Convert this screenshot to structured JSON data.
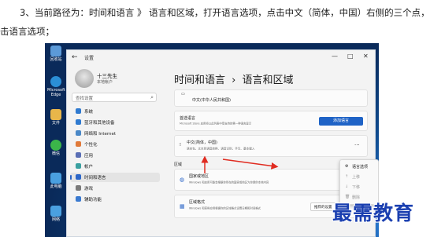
{
  "article": {
    "line1": "3、当前路径为：时间和语言 》 语言和区域，打开语言选项，点击中文（简体，中国）右侧的三个点，再点",
    "line2": "击语言选项；"
  },
  "desktop_icons": [
    {
      "label": "回收站",
      "color": "#5c9ad8"
    },
    {
      "label": "Microsoft Edge",
      "color": "#2b8fd6"
    },
    {
      "label": "文件",
      "color": "#e8b64a"
    },
    {
      "label": "微信",
      "color": "#3bb54a"
    },
    {
      "label": "此电脑",
      "color": "#4aa0e0"
    },
    {
      "label": "网络",
      "color": "#4aa0e0"
    }
  ],
  "window": {
    "title": "设置",
    "back": "←",
    "minimize": "—",
    "maximize": "□",
    "close": "✕"
  },
  "user": {
    "name": "十三先生",
    "account": "本地帐户"
  },
  "search": {
    "placeholder": "查找设置",
    "icon": "search-icon"
  },
  "nav": [
    {
      "label": "系统",
      "color": "#2f7ad0"
    },
    {
      "label": "蓝牙和其他设备",
      "color": "#2f7ad0"
    },
    {
      "label": "网络和 Internet",
      "color": "#4a88c7"
    },
    {
      "label": "个性化",
      "color": "#e07a3a"
    },
    {
      "label": "应用",
      "color": "#5a6fb5"
    },
    {
      "label": "帐户",
      "color": "#3aa0a0"
    },
    {
      "label": "时间和语言",
      "color": "#2b66c8",
      "active": true
    },
    {
      "label": "游戏",
      "color": "#7a7a7a"
    },
    {
      "label": "辅助功能",
      "color": "#3a7ad0"
    }
  ],
  "breadcrumb": {
    "parent": "时间和语言",
    "sep": "›",
    "current": "语言和区域"
  },
  "cards": {
    "display_lang": "中文(中华人民共和国)",
    "pref_title": "首选语言",
    "pref_desc": "Microsoft Store 应用将以此列表中受支持的第一种语言显示",
    "add_button": "添加语言",
    "lang_name": "中文(简体，中国)",
    "lang_desc": "语言包、文本到语音转换、语音识别、手写、基本键入",
    "more": "···",
    "region_section": "区域",
    "country_title": "国家或地区",
    "country_desc": "Windows 和应用可能会根据你所在的国家或地区为你提供本地内容",
    "format_title": "区域格式",
    "format_desc": "Windows 和某些应用根据你的区域格式设置日期和时间格式",
    "format_value": "推荐的设置"
  },
  "context_menu": {
    "items": [
      {
        "label": "语言选项",
        "glyph": "⚙",
        "enabled": true
      },
      {
        "label": "上移",
        "glyph": "↑",
        "enabled": false
      },
      {
        "label": "下移",
        "glyph": "↓",
        "enabled": false
      },
      {
        "label": "删除",
        "glyph": "🗑",
        "enabled": false
      }
    ]
  },
  "watermark": "最需教育",
  "colors": {
    "accent": "#1f63c6",
    "arrow": "#e02b20"
  }
}
